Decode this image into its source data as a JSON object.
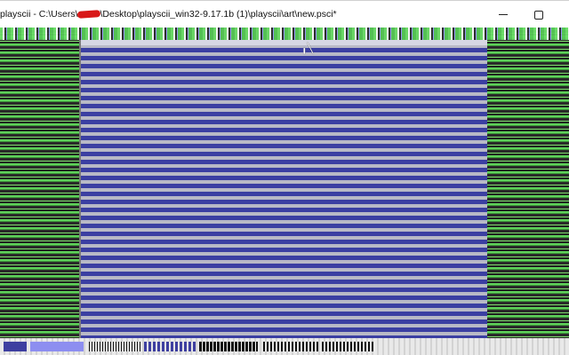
{
  "window": {
    "title_prefix": "playscii - C:\\Users\\",
    "title_suffix": "\\Desktop\\playscii_win32-9.17.1b (1)\\playscii\\art\\new.psci*",
    "minimize_label": "—",
    "maximize_label": "□"
  },
  "canvas": {
    "cursor_glyph": "╻╲"
  },
  "statusbar": {
    "segments": [
      "",
      "",
      "",
      "",
      "",
      "",
      ""
    ]
  },
  "colors": {
    "canvas_fill": "#3b3fa2",
    "canvas_line": "#b8b9c6",
    "background_green": "#5ed05a",
    "redaction": "#d81818"
  }
}
